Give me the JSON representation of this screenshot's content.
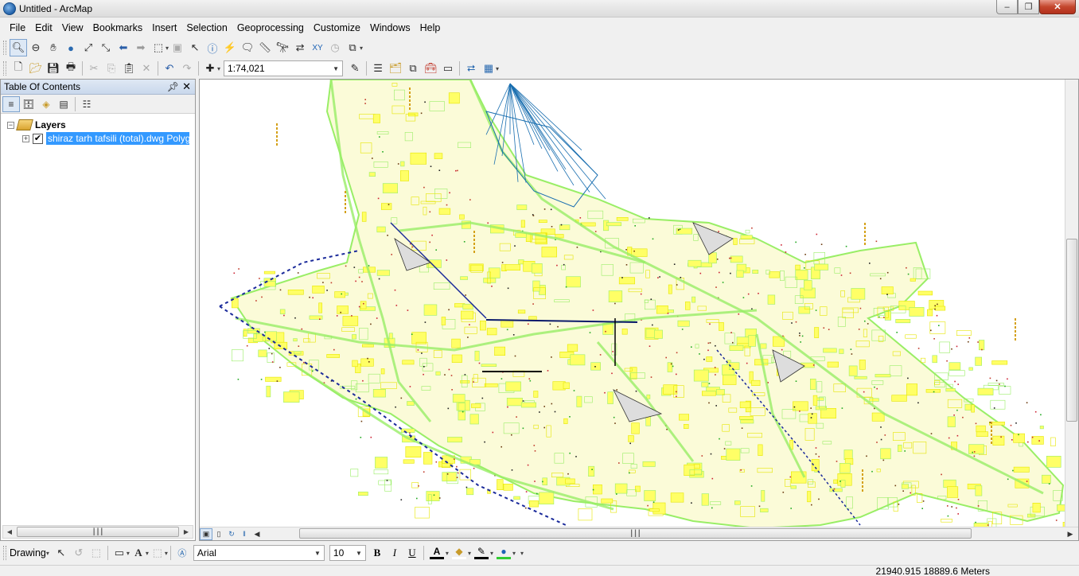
{
  "window": {
    "title": "Untitled - ArcMap"
  },
  "menu": [
    "File",
    "Edit",
    "View",
    "Bookmarks",
    "Insert",
    "Selection",
    "Geoprocessing",
    "Customize",
    "Windows",
    "Help"
  ],
  "toolbar": {
    "scale": "1:74,021"
  },
  "toc": {
    "title": "Table Of Contents",
    "root_label": "Layers",
    "layer_label": "shiraz tarh tafsili (total).dwg Polygon",
    "layer_checked": true
  },
  "drawing": {
    "label": "Drawing",
    "font": "Arial",
    "size": "10"
  },
  "status": {
    "coordinates": "21940.915  18889.6 Meters"
  },
  "colors": {
    "map_yellow": "#ffff66",
    "map_green": "#99ee66",
    "map_blue": "#1a6fb0",
    "selection": "#3399ff"
  }
}
